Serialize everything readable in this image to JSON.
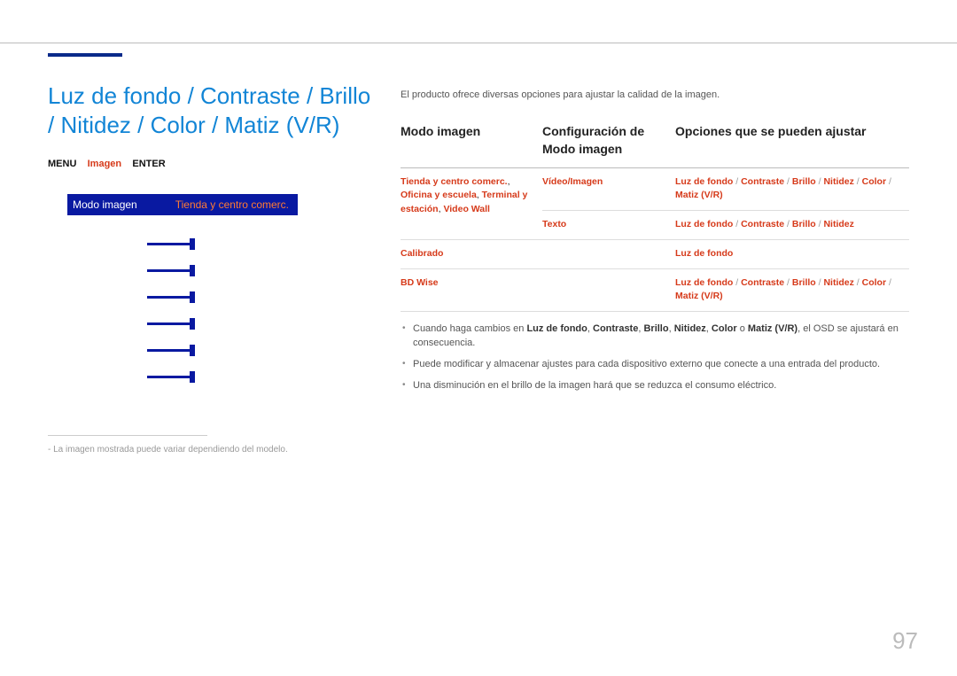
{
  "title": "Luz de fondo / Contraste / Brillo / Nitidez / Color / Matiz (V/R)",
  "breadcrumb": {
    "menu": "MENU",
    "imagen": "Imagen",
    "enter": "ENTER"
  },
  "screenshot": {
    "label": "Modo imagen",
    "value": "Tienda y centro comerc."
  },
  "footnote": "La imagen mostrada puede variar dependiendo del modelo.",
  "intro": "El producto ofrece diversas opciones para ajustar la calidad de la imagen.",
  "headers": {
    "modo": "Modo imagen",
    "config": "Configuración de Modo imagen",
    "opciones": "Opciones que se pueden ajustar"
  },
  "rows": [
    {
      "modo_html": "<span>Tienda y centro comerc.</span><span class='black'>, </span><span>Oficina y escuela</span><span class='black'>, </span><span>Terminal y estación</span><span class='black'>, </span><span>Video Wall</span>",
      "config": "Vídeo/Imagen",
      "opciones_html": "Luz de fondo <span class='sep'>/</span> Contraste <span class='sep'>/</span> Brillo <span class='sep'>/</span> Nitidez <span class='sep'>/</span> Color <span class='sep'>/</span> Matiz (V/R)"
    },
    {
      "modo_html": "",
      "config": "Texto",
      "opciones_html": "Luz de fondo <span class='sep'>/</span> Contraste <span class='sep'>/</span> Brillo <span class='sep'>/</span> Nitidez"
    },
    {
      "modo_html": "<span>Calibrado</span>",
      "config": "",
      "opciones_html": "Luz de fondo"
    },
    {
      "modo_html": "<span>BD Wise</span>",
      "config": "",
      "opciones_html": "Luz de fondo <span class='sep'>/</span> Contraste <span class='sep'>/</span> Brillo <span class='sep'>/</span> Nitidez <span class='sep'>/</span> Color <span class='sep'>/</span> Matiz (V/R)"
    }
  ],
  "notes": [
    "Cuando haga cambios en <b>Luz de fondo</b>, <b>Contraste</b>, <b>Brillo</b>, <b>Nitidez</b>, <b>Color</b> o <b>Matiz (V/R)</b>, el OSD se ajustará en consecuencia.",
    "Puede modificar y almacenar ajustes para cada dispositivo externo que conecte a una entrada del producto.",
    "Una disminución en el brillo de la imagen hará que se reduzca el consumo eléctrico."
  ],
  "page": "97"
}
